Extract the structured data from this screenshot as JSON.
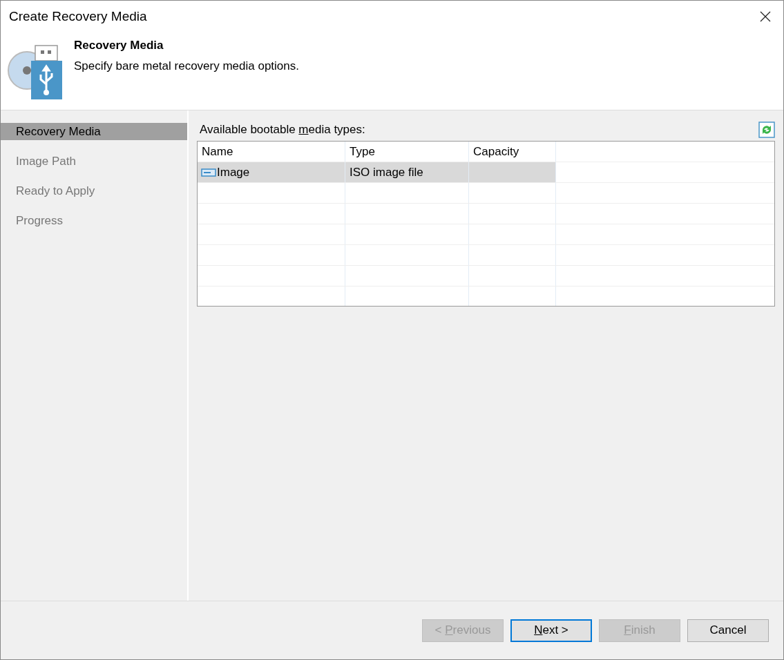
{
  "window": {
    "title": "Create Recovery Media"
  },
  "header": {
    "title": "Recovery Media",
    "subtitle": "Specify bare metal recovery media options."
  },
  "steps": [
    {
      "label": "Recovery Media",
      "selected": true
    },
    {
      "label": "Image Path",
      "selected": false
    },
    {
      "label": "Ready to Apply",
      "selected": false
    },
    {
      "label": "Progress",
      "selected": false
    }
  ],
  "list_label": {
    "before_key": "Available bootable ",
    "access_key": "m",
    "after_key": "edia types:"
  },
  "table": {
    "columns": [
      "Name",
      "Type",
      "Capacity"
    ],
    "rows": [
      {
        "name": "Image",
        "type": "ISO image file",
        "selected": true
      }
    ]
  },
  "buttons": [
    {
      "before_key": "< ",
      "access_key": "P",
      "after_key": "revious",
      "disabled": true,
      "focused": false
    },
    {
      "access_key": "N",
      "after_key": "ext >",
      "disabled": false,
      "focused": true
    },
    {
      "access_key": "F",
      "after_key": "inish",
      "disabled": true,
      "focused": false
    },
    {
      "after_key": "Cancel",
      "disabled": false,
      "focused": false
    }
  ]
}
